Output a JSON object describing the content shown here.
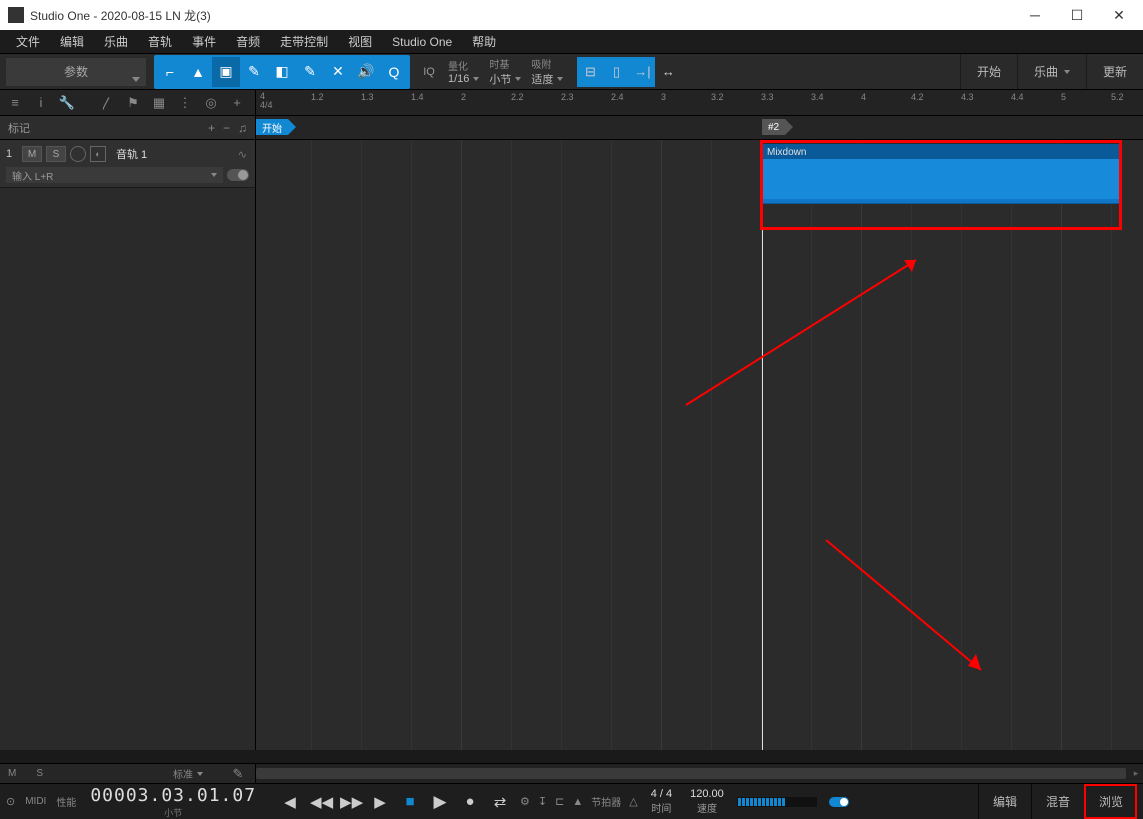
{
  "title": "Studio One - 2020-08-15 LN 龙(3)",
  "menu": [
    "文件",
    "编辑",
    "乐曲",
    "音轨",
    "事件",
    "音频",
    "走带控制",
    "视图",
    "Studio One",
    "帮助"
  ],
  "toolbar": {
    "param": "参数",
    "quantize_lbl": "量化",
    "quantize_val": "1/16",
    "timebase_lbl": "时基",
    "timebase_val": "小节",
    "snap_lbl": "吸附",
    "snap_val": "适度",
    "iq": "IQ",
    "start": "开始",
    "song": "乐曲",
    "update": "更新"
  },
  "ruler": {
    "sig_top": "4",
    "sig_bot": "4/4",
    "ticks": [
      "1.2",
      "1.3",
      "1.4",
      "2",
      "2.2",
      "2.3",
      "2.4",
      "3",
      "3.2",
      "3.3",
      "3.4",
      "4",
      "4.2",
      "4.3",
      "4.4",
      "5",
      "5.2"
    ]
  },
  "marker": {
    "label": "标记",
    "start": "开始",
    "two": "#2"
  },
  "track": {
    "num": "1",
    "m": "M",
    "s": "S",
    "name": "音轨 1",
    "input": "输入 L+R"
  },
  "clip": {
    "name": "Mixdown"
  },
  "bottom": {
    "m": "M",
    "s": "S",
    "auto": "标准"
  },
  "transport": {
    "midi": "MIDI",
    "perf": "性能",
    "time": "00003.03.01.07",
    "time_unit": "小节",
    "metronome": "节拍器",
    "timesig": "4 / 4",
    "timesig_lbl": "时间",
    "tempo": "120.00",
    "tempo_lbl": "速度",
    "edit": "编辑",
    "mix": "混音",
    "browse": "浏览"
  }
}
